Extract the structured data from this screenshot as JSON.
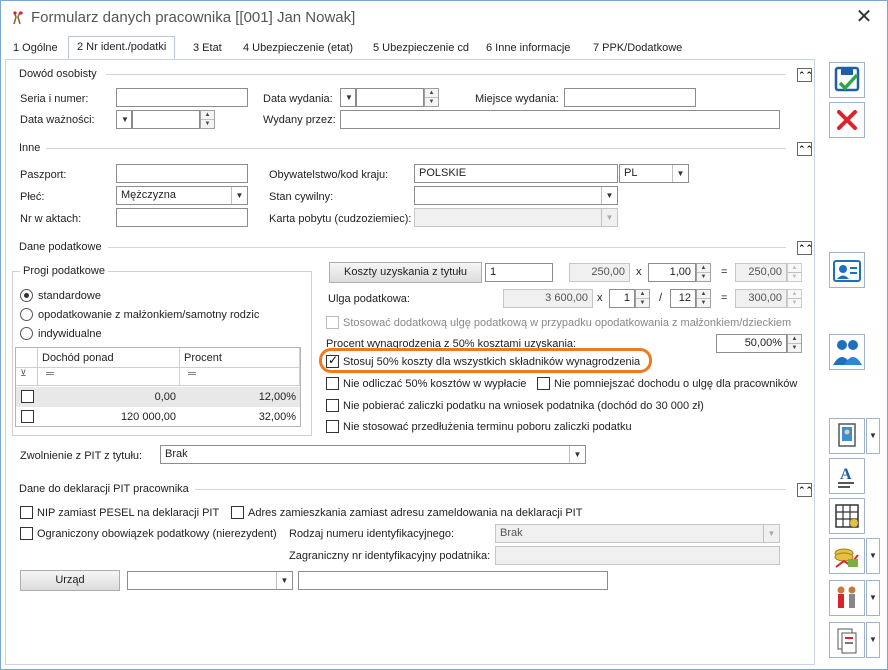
{
  "window": {
    "title": "Formularz danych pracownika [[001] Jan Nowak]"
  },
  "tabs": [
    {
      "label": "1 Ogólne"
    },
    {
      "label": "2 Nr ident./podatki"
    },
    {
      "label": "3 Etat"
    },
    {
      "label": "4 Ubezpieczenie (etat)"
    },
    {
      "label": "5 Ubezpieczenie cd"
    },
    {
      "label": "6 Inne informacje"
    },
    {
      "label": "7 PPK/Dodatkowe"
    }
  ],
  "dowod": {
    "title": "Dowód osobisty",
    "seria_label": "Seria i numer:",
    "seria_value": "",
    "data_waznosci_label": "Data ważności:",
    "data_wydania_label": "Data wydania:",
    "wydany_przez_label": "Wydany przez:",
    "miejsce_wydania_label": "Miejsce wydania:"
  },
  "inne": {
    "title": "Inne",
    "paszport_label": "Paszport:",
    "plec_label": "Płeć:",
    "plec_value": "Mężczyzna",
    "nr_akt_label": "Nr w aktach:",
    "obyw_label": "Obywatelstwo/kod kraju:",
    "obyw_value": "POLSKIE",
    "kod_kraju_value": "PL",
    "stan_label": "Stan cywilny:",
    "karta_label": "Karta pobytu (cudzoziemiec):"
  },
  "podatki": {
    "title": "Dane podatkowe",
    "progi_title": "Progi podatkowe",
    "radio_standard": "standardowe",
    "radio_malzonek": "opodatkowanie z małżonkiem/samotny rodzic",
    "radio_indyw": "indywidualne",
    "grid_headers": [
      "Dochód ponad",
      "Procent"
    ],
    "grid_filter": "═",
    "grid_rows": [
      {
        "dochod": "0,00",
        "procent": "12,00%"
      },
      {
        "dochod": "120 000,00",
        "procent": "32,00%"
      }
    ],
    "koszty_button": "Koszty uzyskania z tytułu",
    "koszty_count": "1",
    "koszty_amount": "250,00",
    "koszty_mult": "1,00",
    "koszty_result": "250,00",
    "ulga_label": "Ulga podatkowa:",
    "ulga_amount": "3 600,00",
    "ulga_num": "1",
    "ulga_den": "12",
    "ulga_result": "300,00",
    "op_x": "x",
    "op_eq": "=",
    "op_slash": "/",
    "dodatkowa_ulga": "Stosować dodatkową ulgę podatkową w przypadku opodatkowania z małżonkiem/dzieckiem",
    "procent_label": "Procent wynagrodzenia z 50% kosztami uzyskania:",
    "procent_value": "50,00%",
    "stosuj50": "Stosuj 50% koszty dla wszystkich składników wynagrodzenia",
    "nie_odliczac": "Nie odliczać 50% kosztów w wypłacie",
    "nie_pomniejszac": "Nie pomniejszać dochodu o ulgę dla pracowników",
    "nie_pobierac": "Nie pobierać zaliczki podatku na wniosek podatnika (dochód do 30 000 zł)",
    "nie_stosowac": "Nie stosować przedłużenia terminu poboru zaliczki podatku",
    "zwolnienie_label": "Zwolnienie z PIT z tytułu:",
    "zwolnienie_value": "Brak"
  },
  "pit": {
    "title": "Dane do deklaracji PIT pracownika",
    "nip_zamiast": "NIP zamiast PESEL na deklaracji PIT",
    "adres_zamiast": "Adres zamieszkania zamiast adresu zameldowania na deklaracji PIT",
    "ograniczony": "Ograniczony obowiązek podatkowy (nierezydent)",
    "rodzaj_label": "Rodzaj numeru identyfikacyjnego:",
    "rodzaj_value": "Brak",
    "zagr_label": "Zagraniczny nr identyfikacyjny podatnika:",
    "urzad_button": "Urząd"
  },
  "icons": {
    "save": "save-check-icon",
    "cancel": "red-x-icon",
    "employee_card": "employee-card-icon",
    "people": "people-icon"
  },
  "colors": {
    "accent": "#1f6fbf",
    "highlight": "#f07a1e",
    "cancel": "#d9232d"
  }
}
